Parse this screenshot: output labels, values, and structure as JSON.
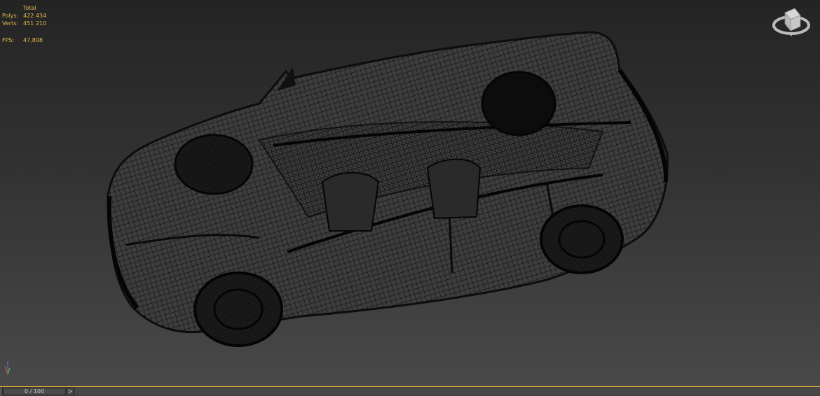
{
  "stats": {
    "header": "Total",
    "polys_label": "Polys:",
    "polys_value": "422 434",
    "verts_label": "Verts:",
    "verts_value": "451 210",
    "fps_label": "FPS:",
    "fps_value": "47,808"
  },
  "timeline": {
    "frame_counter": "0 / 100",
    "next_glyph": ">"
  },
  "colors": {
    "stats_text": "#e0b84a",
    "timeline_accent": "#d9a93a",
    "wire": "#0d0d0d"
  },
  "icons": {
    "viewcube": "viewcube-icon",
    "axis": "axis-tripod-icon"
  }
}
